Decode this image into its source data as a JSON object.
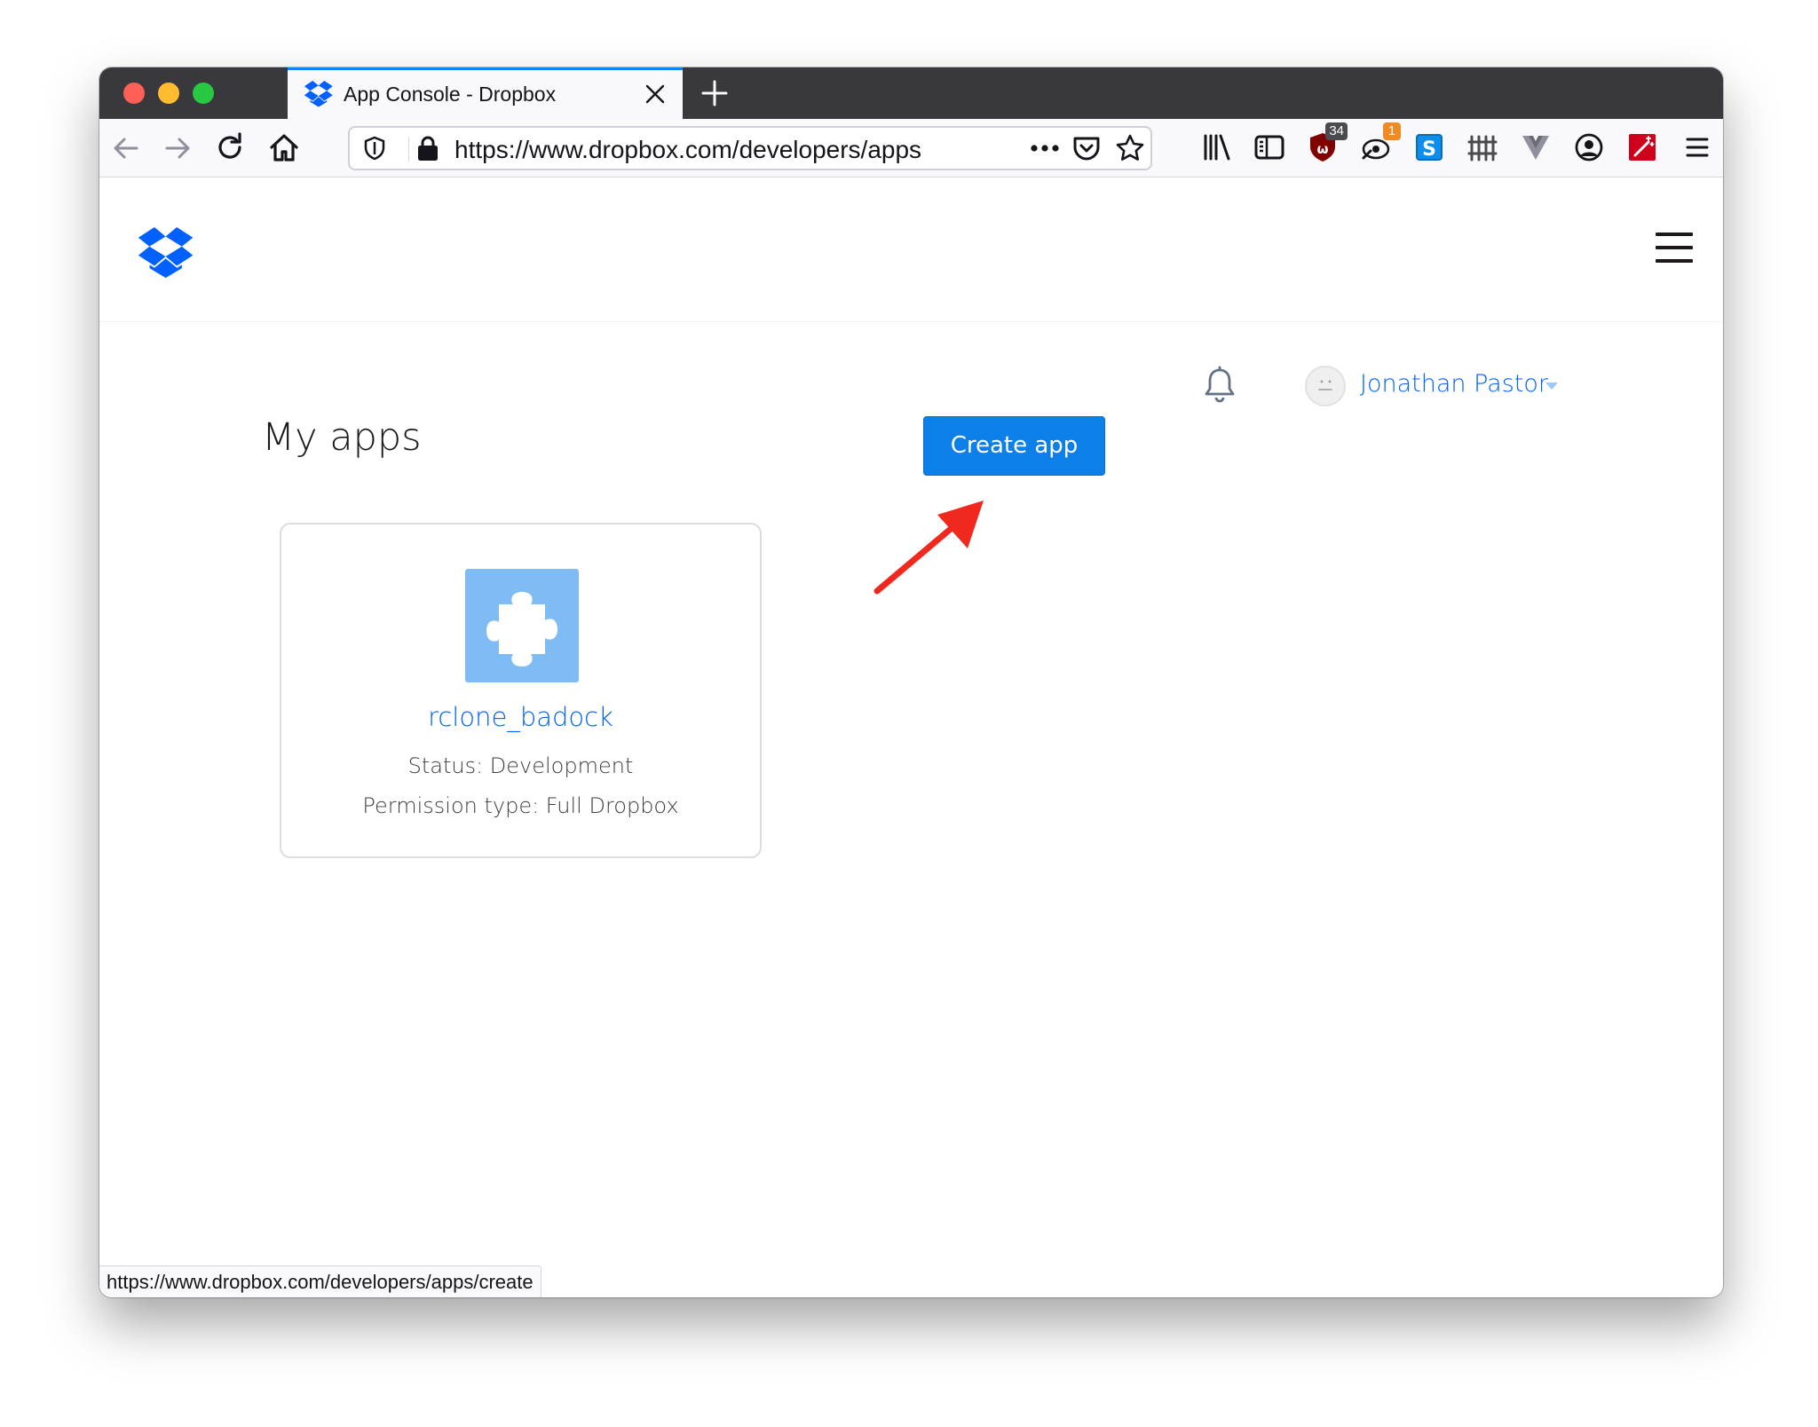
{
  "browser": {
    "tab": {
      "title": "App Console - Dropbox"
    },
    "url": "https://www.dropbox.com/developers/apps",
    "status_url": "https://www.dropbox.com/developers/apps/create",
    "extensions": [
      {
        "name": "ublock-icon",
        "badge": "34",
        "badge_color": "#4a4a4f"
      },
      {
        "name": "tampermonkey-icon",
        "badge": "1",
        "badge_color": "#f08a24"
      },
      {
        "name": "skype-icon"
      },
      {
        "name": "fence-icon"
      },
      {
        "name": "vue-devtools-icon"
      },
      {
        "name": "account-icon"
      },
      {
        "name": "magic-wand-icon"
      }
    ]
  },
  "page": {
    "user": {
      "name": "Jonathan Pastor"
    },
    "title": "My apps",
    "create_button": "Create app",
    "apps": [
      {
        "name": "rclone_badock",
        "status": "Status: Development",
        "permission": "Permission type: Full Dropbox"
      }
    ]
  },
  "colors": {
    "brand_blue": "#0061fe",
    "button_blue": "#0d7fe8",
    "annotation_arrow": "#f0281e"
  }
}
